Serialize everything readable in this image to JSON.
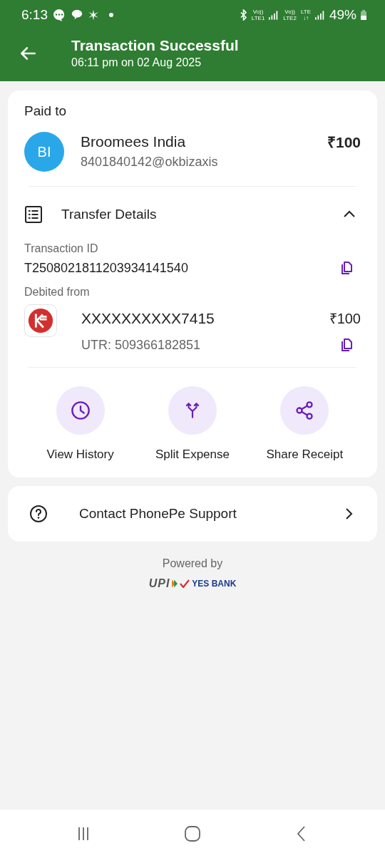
{
  "status_bar": {
    "time": "6:13",
    "network_labels": [
      {
        "top": "Vo))",
        "bottom": "LTE1"
      },
      {
        "top": "Vo))",
        "bottom": "LTE2"
      },
      {
        "top": "LTE",
        "bottom": "↓↑"
      }
    ],
    "battery": "49%"
  },
  "header": {
    "title": "Transaction Successful",
    "subtitle": "06:11 pm on 02 Aug 2025"
  },
  "payee": {
    "label": "Paid to",
    "initials": "BI",
    "name": "Broomees India",
    "upi_id": "8401840142@okbizaxis",
    "amount": "₹100"
  },
  "transfer_details": {
    "title": "Transfer Details",
    "expanded": true,
    "transaction_id_label": "Transaction ID",
    "transaction_id": "T2508021811203934141540",
    "debited_label": "Debited from",
    "account": "XXXXXXXXXX7415",
    "account_amount": "₹100",
    "utr": "UTR: 509366182851"
  },
  "actions": [
    {
      "kind": "history",
      "label": "View History"
    },
    {
      "kind": "split",
      "label": "Split Expense"
    },
    {
      "kind": "share",
      "label": "Share Receipt"
    }
  ],
  "support": {
    "label": "Contact PhonePe Support"
  },
  "footer": {
    "powered_by": "Powered by",
    "upi": "UPI",
    "bank": "YES BANK"
  }
}
